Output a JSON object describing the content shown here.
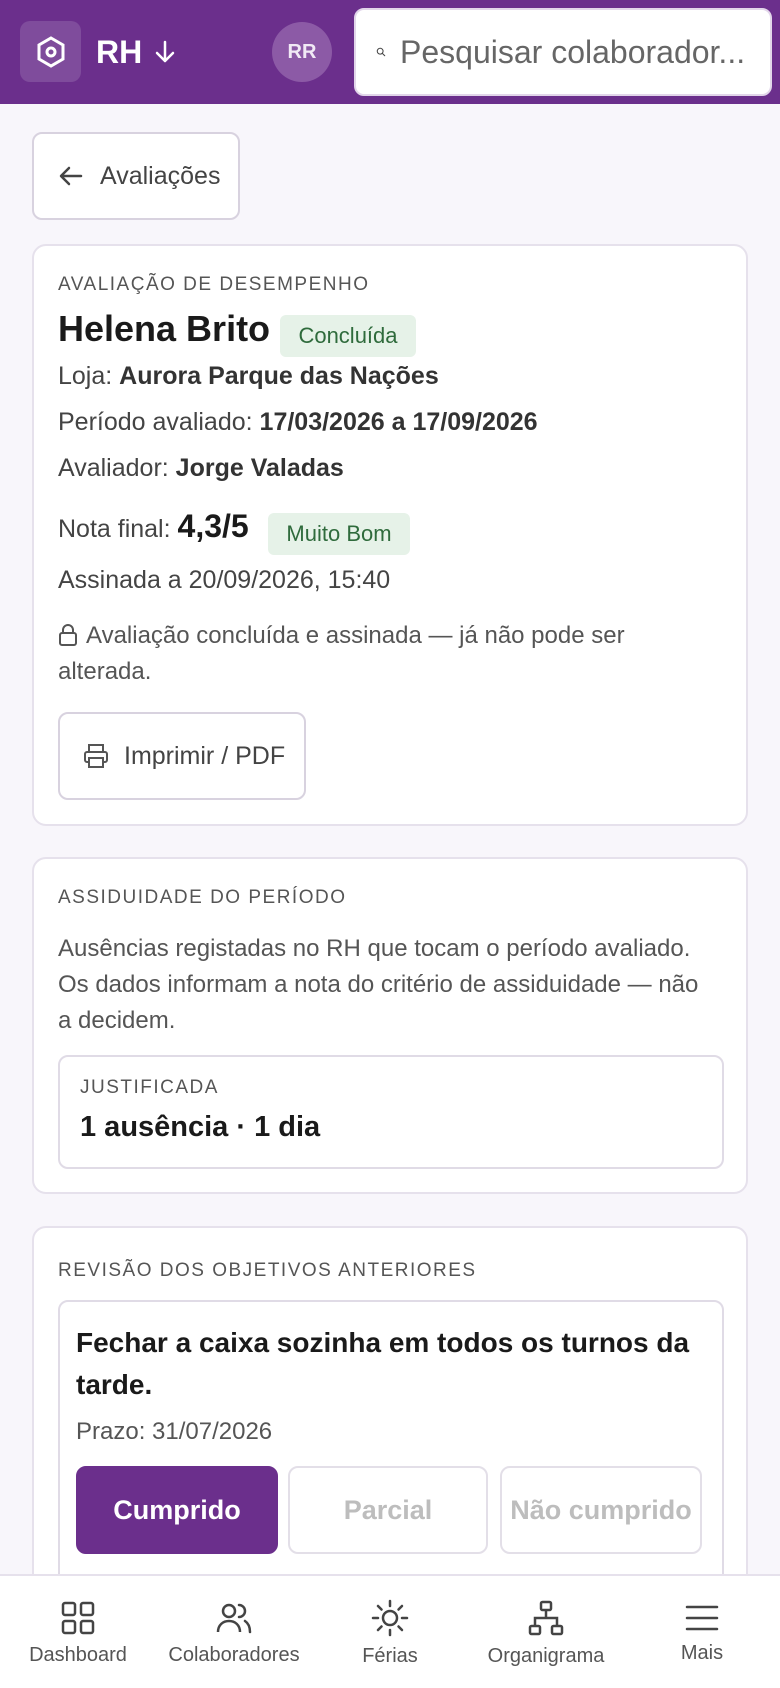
{
  "header": {
    "app_name": "RH",
    "avatar_initials": "RR",
    "search_placeholder": "Pesquisar colaborador...",
    "brand_color": "#6b2f8c"
  },
  "back": {
    "label": "Avaliações"
  },
  "evaluation": {
    "eyebrow": "AVALIAÇÃO DE DESEMPENHO",
    "employee_name": "Helena Brito",
    "status_badge": "Concluída",
    "store_label": "Loja:",
    "store_value": "Aurora Parque das Nações",
    "period_label": "Período avaliado:",
    "period_value": "17/03/2026 a 17/09/2026",
    "evaluator_label": "Avaliador:",
    "evaluator_value": "Jorge Valadas",
    "score_label": "Nota final:",
    "score_value": "4,3/5",
    "score_badge": "Muito Bom",
    "signed": "Assinada a 20/09/2026, 15:40",
    "locked_notice": "Avaliação concluída e assinada — já não pode ser alterada.",
    "print_label": "Imprimir / PDF"
  },
  "attendance": {
    "eyebrow": "ASSIDUIDADE DO PERÍODO",
    "description": "Ausências registadas no RH que tocam o período avaliado. Os dados informam a nota do critério de assiduidade — não a decidem.",
    "type_label": "JUSTIFICADA",
    "summary": "1 ausência · 1 dia"
  },
  "objectives": {
    "eyebrow": "REVISÃO DOS OBJETIVOS ANTERIORES",
    "items": [
      {
        "title": "Fechar a caixa sozinha em todos os turnos da tarde.",
        "deadline": "Prazo: 31/07/2026",
        "options": [
          "Cumprido",
          "Parcial",
          "Não cumprido"
        ],
        "selected": "Cumprido"
      }
    ]
  },
  "bottom_nav": {
    "items": [
      {
        "label": "Dashboard",
        "icon": "dashboard-icon"
      },
      {
        "label": "Colaboradores",
        "icon": "people-icon"
      },
      {
        "label": "Férias",
        "icon": "sun-icon"
      },
      {
        "label": "Organigrama",
        "icon": "org-chart-icon"
      },
      {
        "label": "Mais",
        "icon": "menu-icon"
      }
    ]
  }
}
